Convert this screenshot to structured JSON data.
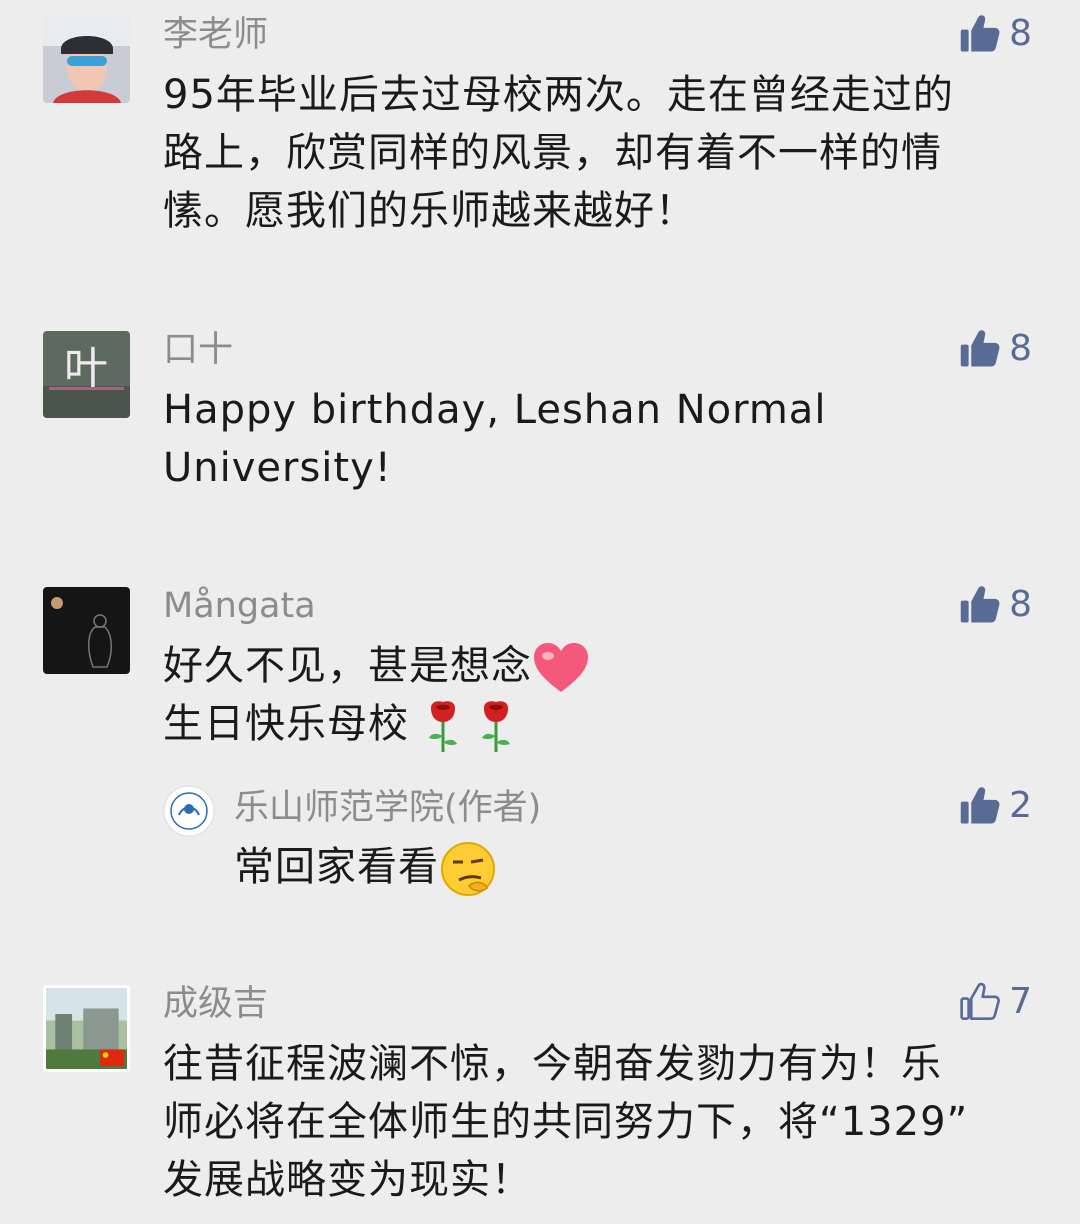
{
  "colors": {
    "background": "#ededed",
    "name_text": "#8c8c8c",
    "body_text": "#1a1a1a",
    "like_accent": "#576b95"
  },
  "comments": [
    {
      "author": "李老师",
      "likes": "8",
      "liked": true,
      "lines": [
        "95年毕业后去过母校两次。走在曾经走过的",
        "路上，欣赏同样的风景，却有着不一样的情",
        "愫。愿我们的乐师越来越好！"
      ]
    },
    {
      "author": "口十",
      "avatar_text": "叶",
      "likes": "8",
      "liked": true,
      "lines": [
        "Happy birthday, Leshan Normal",
        "University!"
      ]
    },
    {
      "author": "Mångata",
      "likes": "8",
      "liked": true,
      "lines": [
        "好久不见，甚是想念",
        "生日快乐母校"
      ],
      "emojis": [
        "heart-emoji",
        "rose-emoji",
        "rose-emoji"
      ],
      "reply": {
        "author": "乐山师范学院(作者)",
        "likes": "2",
        "liked": true,
        "text": "常回家看看",
        "emoji": "smirk-emoji"
      }
    },
    {
      "author": "成级吉",
      "likes": "7",
      "liked": false,
      "lines": [
        "往昔征程波澜不惊，今朝奋发勠力有为！乐",
        "师必将在全体师生的共同努力下，将“1329”",
        "发展战略变为现实！"
      ]
    }
  ]
}
